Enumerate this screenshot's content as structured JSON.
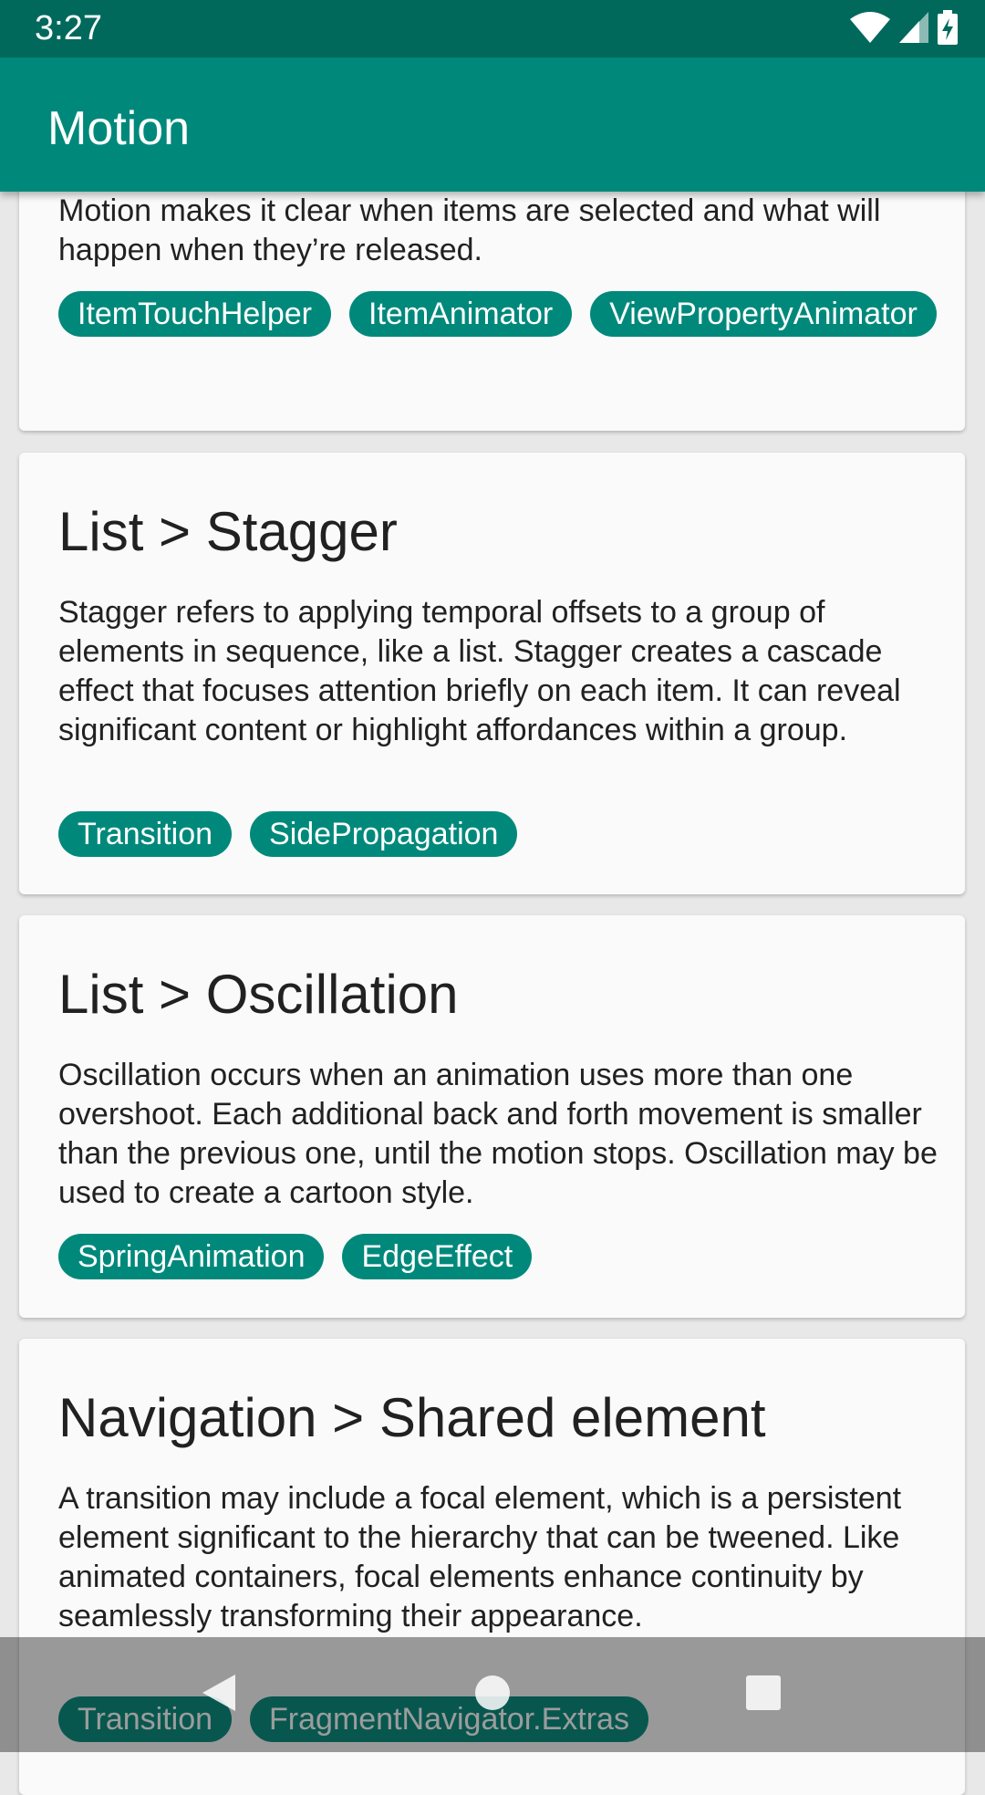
{
  "status_bar": {
    "time": "3:27",
    "icons": [
      "wifi-icon",
      "cell-signal-icon",
      "battery-charging-icon"
    ]
  },
  "app_bar": {
    "title": "Motion"
  },
  "cards": [
    {
      "title": "",
      "description": "Motion makes it clear when items are selected and what will happen when they’re released.",
      "chips": [
        "ItemTouchHelper",
        "ItemAnimator",
        "ViewPropertyAnimator"
      ]
    },
    {
      "title": "List > Stagger",
      "description": "Stagger refers to applying temporal offsets to a group of elements in sequence, like a list. Stagger creates a cascade effect that focuses attention briefly on each item. It can reveal significant content or highlight affordances within a group.",
      "chips": [
        "Transition",
        "SidePropagation"
      ]
    },
    {
      "title": "List > Oscillation",
      "description": "Oscillation occurs when an animation uses more than one overshoot. Each additional back and forth movement is smaller than the previous one, until the motion stops. Oscillation may be used to create a cartoon style.",
      "chips": [
        "SpringAnimation",
        "EdgeEffect"
      ]
    },
    {
      "title": "Navigation > Shared element",
      "description": "A transition may include a focal element, which is a persistent element significant to the hierarchy that can be tweened. Like animated containers, focal elements enhance continuity by seamlessly transforming their appearance.",
      "chips": [
        "Transition",
        "FragmentNavigator.Extras"
      ]
    }
  ],
  "nav_bar": {
    "buttons": [
      "back-icon",
      "home-icon",
      "recents-icon"
    ]
  },
  "colors": {
    "status_bar": "#00695c",
    "app_bar": "#00897b",
    "chip": "#00897b",
    "card": "#fafafa",
    "background": "#e8e8e8"
  }
}
